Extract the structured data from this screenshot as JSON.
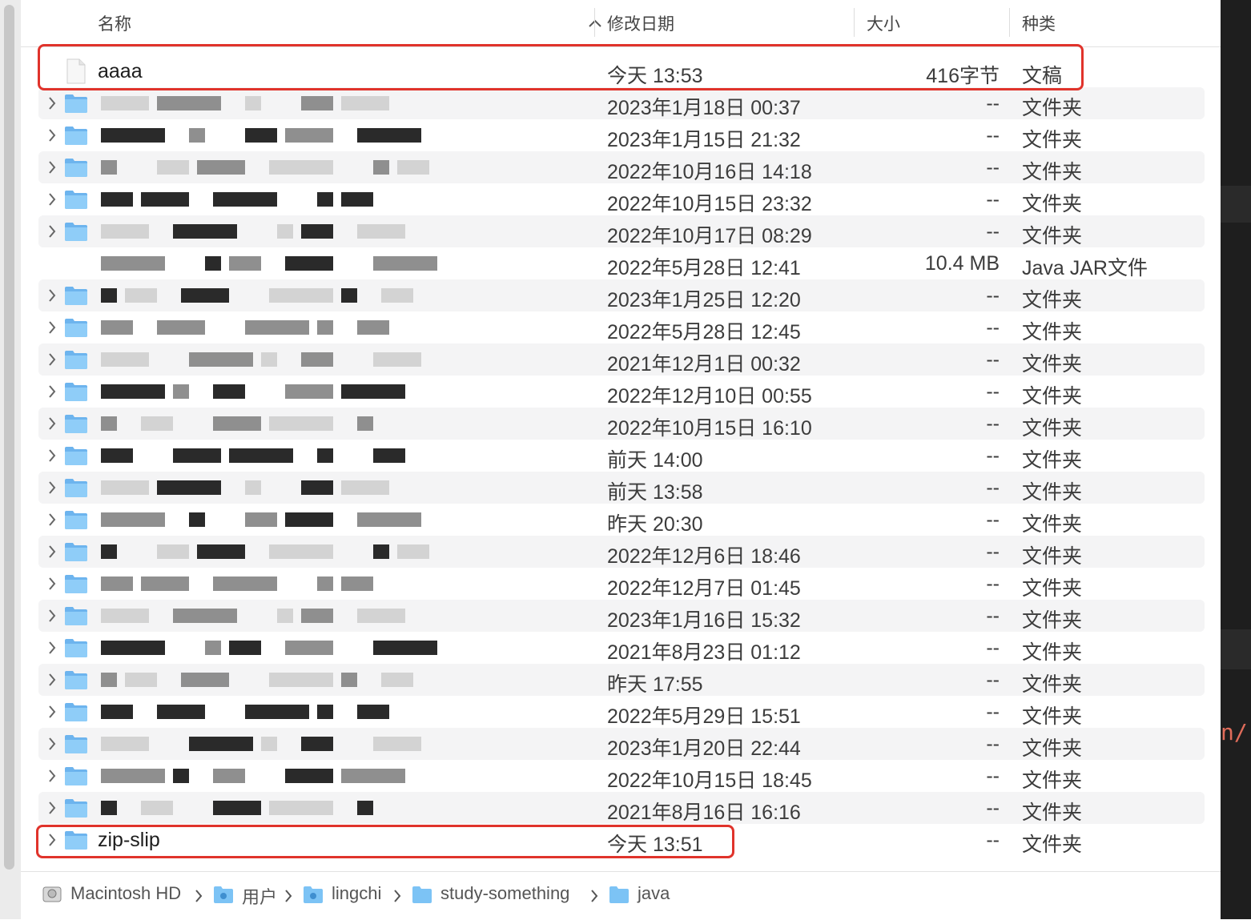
{
  "header": {
    "name_label": "名称",
    "date_label": "修改日期",
    "size_label": "大小",
    "kind_label": "种类"
  },
  "rows": [
    {
      "name": "aaaa",
      "date": "今天 13:53",
      "size": "416字节",
      "kind": "文稿"
    },
    {
      "name": "",
      "date": "2023年1月18日 00:37",
      "size": "--",
      "kind": "文件夹"
    },
    {
      "name": "",
      "date": "2023年1月15日 21:32",
      "size": "--",
      "kind": "文件夹"
    },
    {
      "name": "",
      "date": "2022年10月16日 14:18",
      "size": "--",
      "kind": "文件夹"
    },
    {
      "name": "",
      "date": "2022年10月15日 23:32",
      "size": "--",
      "kind": "文件夹"
    },
    {
      "name": "",
      "date": "2022年10月17日 08:29",
      "size": "--",
      "kind": "文件夹"
    },
    {
      "name": "",
      "date": "2022年5月28日 12:41",
      "size": "10.4 MB",
      "kind": "Java JAR文件"
    },
    {
      "name": "",
      "date": "2023年1月25日 12:20",
      "size": "--",
      "kind": "文件夹"
    },
    {
      "name": "",
      "date": "2022年5月28日 12:45",
      "size": "--",
      "kind": "文件夹"
    },
    {
      "name": "",
      "date": "2021年12月1日 00:32",
      "size": "--",
      "kind": "文件夹"
    },
    {
      "name": "",
      "date": "2022年12月10日 00:55",
      "size": "--",
      "kind": "文件夹"
    },
    {
      "name": "",
      "date": "2022年10月15日 16:10",
      "size": "--",
      "kind": "文件夹"
    },
    {
      "name": "",
      "date": "前天 14:00",
      "size": "--",
      "kind": "文件夹"
    },
    {
      "name": "",
      "date": "前天 13:58",
      "size": "--",
      "kind": "文件夹"
    },
    {
      "name": "",
      "date": "昨天 20:30",
      "size": "--",
      "kind": "文件夹"
    },
    {
      "name": "",
      "date": "2022年12月6日 18:46",
      "size": "--",
      "kind": "文件夹"
    },
    {
      "name": "",
      "date": "2022年12月7日 01:45",
      "size": "--",
      "kind": "文件夹"
    },
    {
      "name": "",
      "date": "2023年1月16日 15:32",
      "size": "--",
      "kind": "文件夹"
    },
    {
      "name": "",
      "date": "2021年8月23日 01:12",
      "size": "--",
      "kind": "文件夹"
    },
    {
      "name": "",
      "date": "昨天 17:55",
      "size": "--",
      "kind": "文件夹"
    },
    {
      "name": "",
      "date": "2022年5月29日 15:51",
      "size": "--",
      "kind": "文件夹"
    },
    {
      "name": "",
      "date": "2023年1月20日 22:44",
      "size": "--",
      "kind": "文件夹"
    },
    {
      "name": "",
      "date": "2022年10月15日 18:45",
      "size": "--",
      "kind": "文件夹"
    },
    {
      "name": "",
      "date": "2021年8月16日 16:16",
      "size": "--",
      "kind": "文件夹"
    },
    {
      "name": "zip-slip",
      "date": "今天 13:51",
      "size": "--",
      "kind": "文件夹"
    }
  ],
  "path_bar": {
    "items": [
      "Macintosh HD",
      "用户",
      "lingchi",
      "study-something",
      "java"
    ]
  },
  "editor_fragment": "n/",
  "colors": {
    "highlight": "#e0332b",
    "folder": "#7cc3f5",
    "row_stripe": "#f4f4f5"
  }
}
